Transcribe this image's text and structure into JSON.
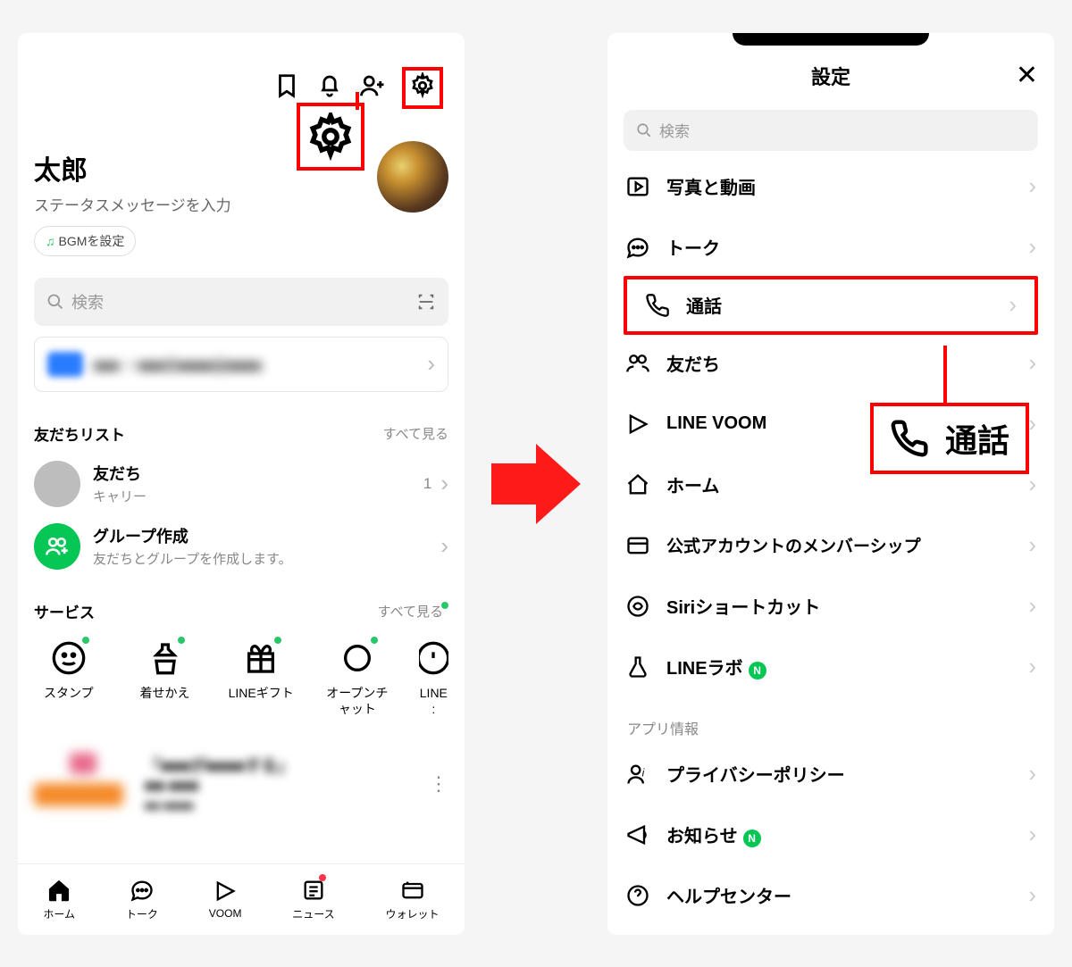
{
  "left": {
    "profile_name": "太郎",
    "profile_status": "ステータスメッセージを入力",
    "bgm_label": "BGMを設定",
    "search_placeholder": "検索",
    "friend_list_header": "友だちリスト",
    "see_all": "すべて見る",
    "friend_item_title": "友だち",
    "friend_item_sub": "キャリー",
    "friend_item_count": "1",
    "group_item_title": "グループ作成",
    "group_item_sub": "友だちとグループを作成します。",
    "services_header": "サービス",
    "services": {
      "s0": "スタンプ",
      "s1": "着せかえ",
      "s2": "LINEギフト",
      "s3": "オープンチャット",
      "s4": "LINE :"
    },
    "tabs": {
      "t0": "ホーム",
      "t1": "トーク",
      "t2": "VOOM",
      "t3": "ニュース",
      "t4": "ウォレット"
    }
  },
  "right": {
    "header_title": "設定",
    "search_placeholder": "検索",
    "rows": {
      "photo": "写真と動画",
      "talk": "トーク",
      "call": "通話",
      "friends": "友だち",
      "voom": "LINE VOOM",
      "home": "ホーム",
      "membership": "公式アカウントのメンバーシップ",
      "siri": "Siriショートカット",
      "labs": "LINEラボ",
      "privacy": "プライバシーポリシー",
      "notice": "お知らせ",
      "help": "ヘルプセンター"
    },
    "section_app_info": "アプリ情報",
    "callout_label": "通話",
    "n_badge": "N"
  }
}
